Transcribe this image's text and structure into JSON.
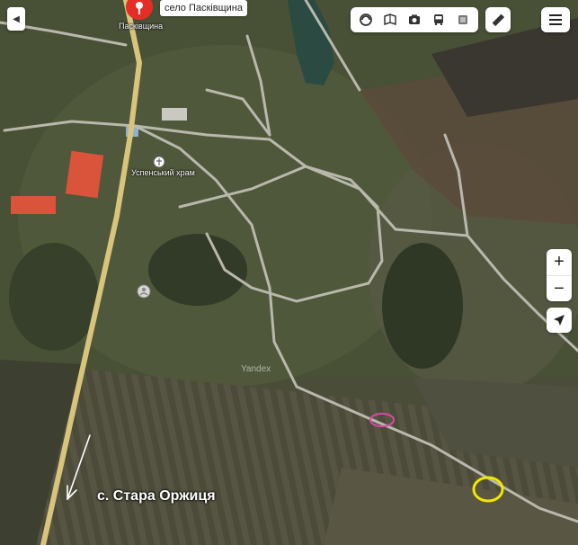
{
  "map": {
    "settlement_pin_label": "село Пасківщина",
    "settlement_below_pin": "Пасківщина",
    "church_label": "Успенський храм",
    "watermark": "Yandex",
    "annotation_text": "с. Стара Оржиця"
  },
  "controls": {
    "zoom_in": "+",
    "zoom_out": "−",
    "sidebar_toggle": "◀",
    "toolbar_icons": [
      "layers-icon",
      "panorama-icon",
      "camera-icon",
      "transit-icon",
      "traffic-icon"
    ],
    "ruler_icon": "ruler-icon",
    "menu_icon": "menu-icon",
    "locate_icon": "locate-arrow-icon"
  },
  "colors": {
    "pin_red": "#e52d27",
    "highlight_pink": "#d84ba8",
    "highlight_yellow": "#f2e600",
    "road_main": "#d8c47a"
  }
}
